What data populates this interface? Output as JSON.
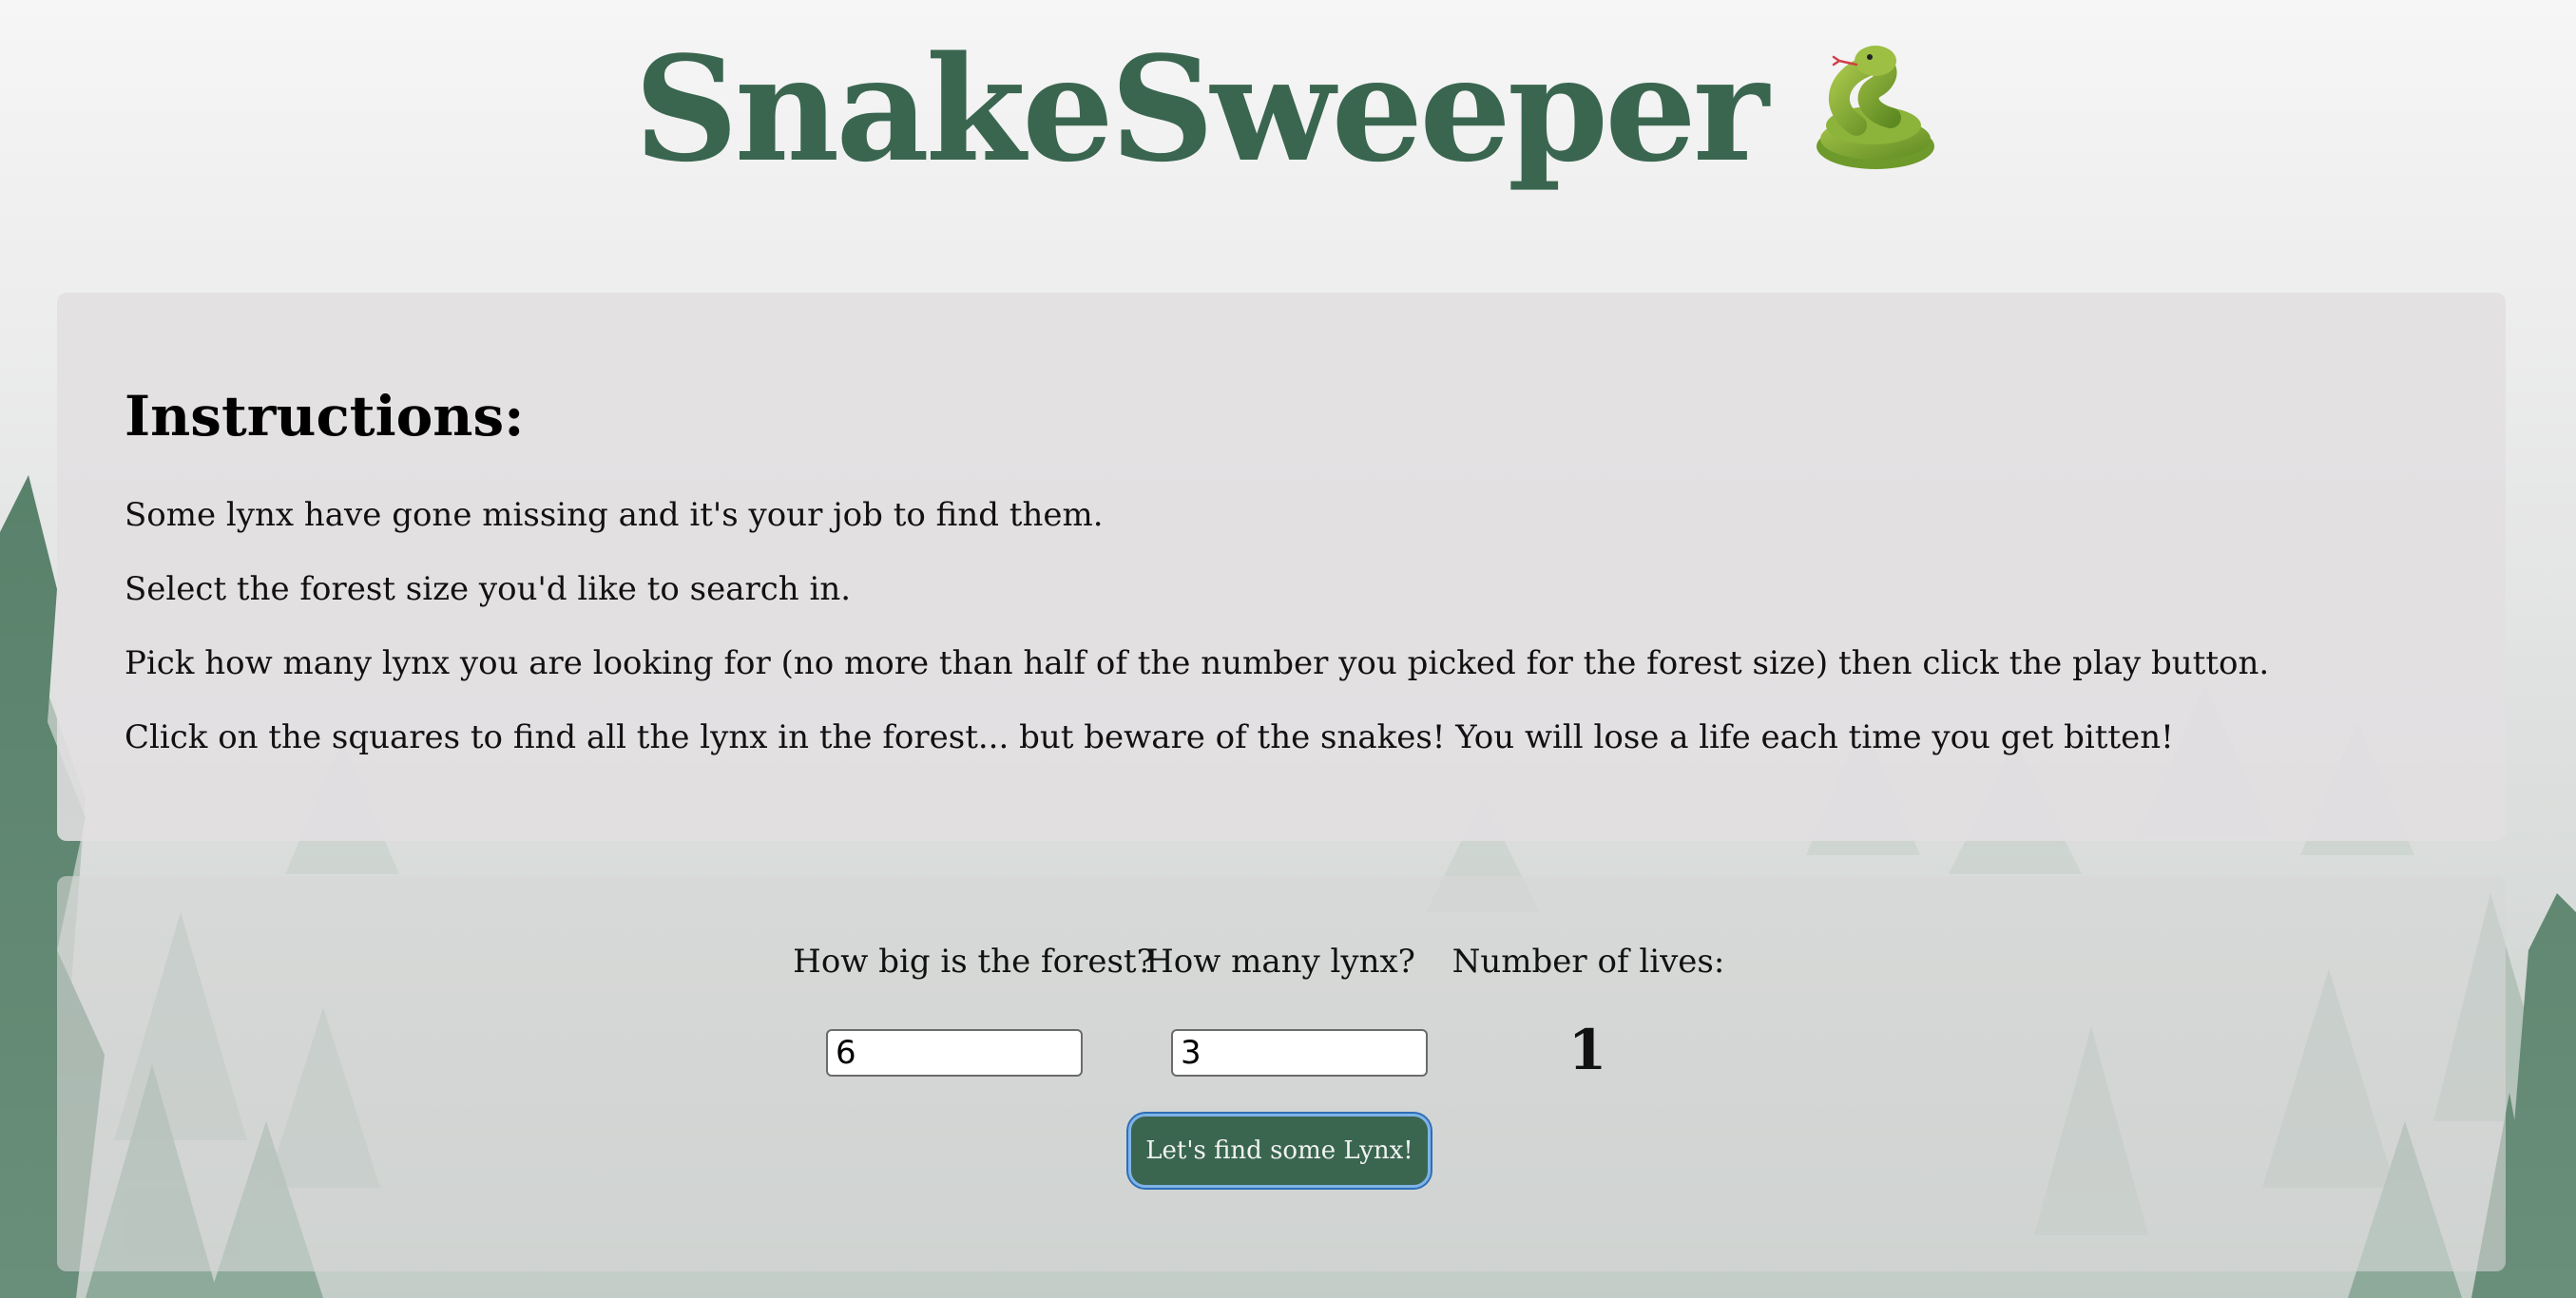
{
  "header": {
    "title": "SnakeSweeper",
    "icon": "snake-icon"
  },
  "instructions": {
    "heading": "Instructions:",
    "lines": [
      "Some lynx have gone missing and it's your job to find them.",
      "Select the forest size you'd like to search in.",
      "Pick how many lynx you are looking for (no more than half of the number you picked for the forest size) then click the play button.",
      "Click on the squares to find all the lynx in the forest... but beware of the snakes! You will lose a life each time you get bitten!"
    ]
  },
  "controls": {
    "forest_label": "How big is the forest?",
    "forest_value": "6",
    "lynx_label": "How many lynx?",
    "lynx_value": "3",
    "lives_label": "Number of lives:",
    "lives_value": "1",
    "play_label": "Let's find some Lynx!"
  },
  "colors": {
    "brand_green": "#3a6650",
    "button_focus_ring": "#2d6fb5"
  }
}
